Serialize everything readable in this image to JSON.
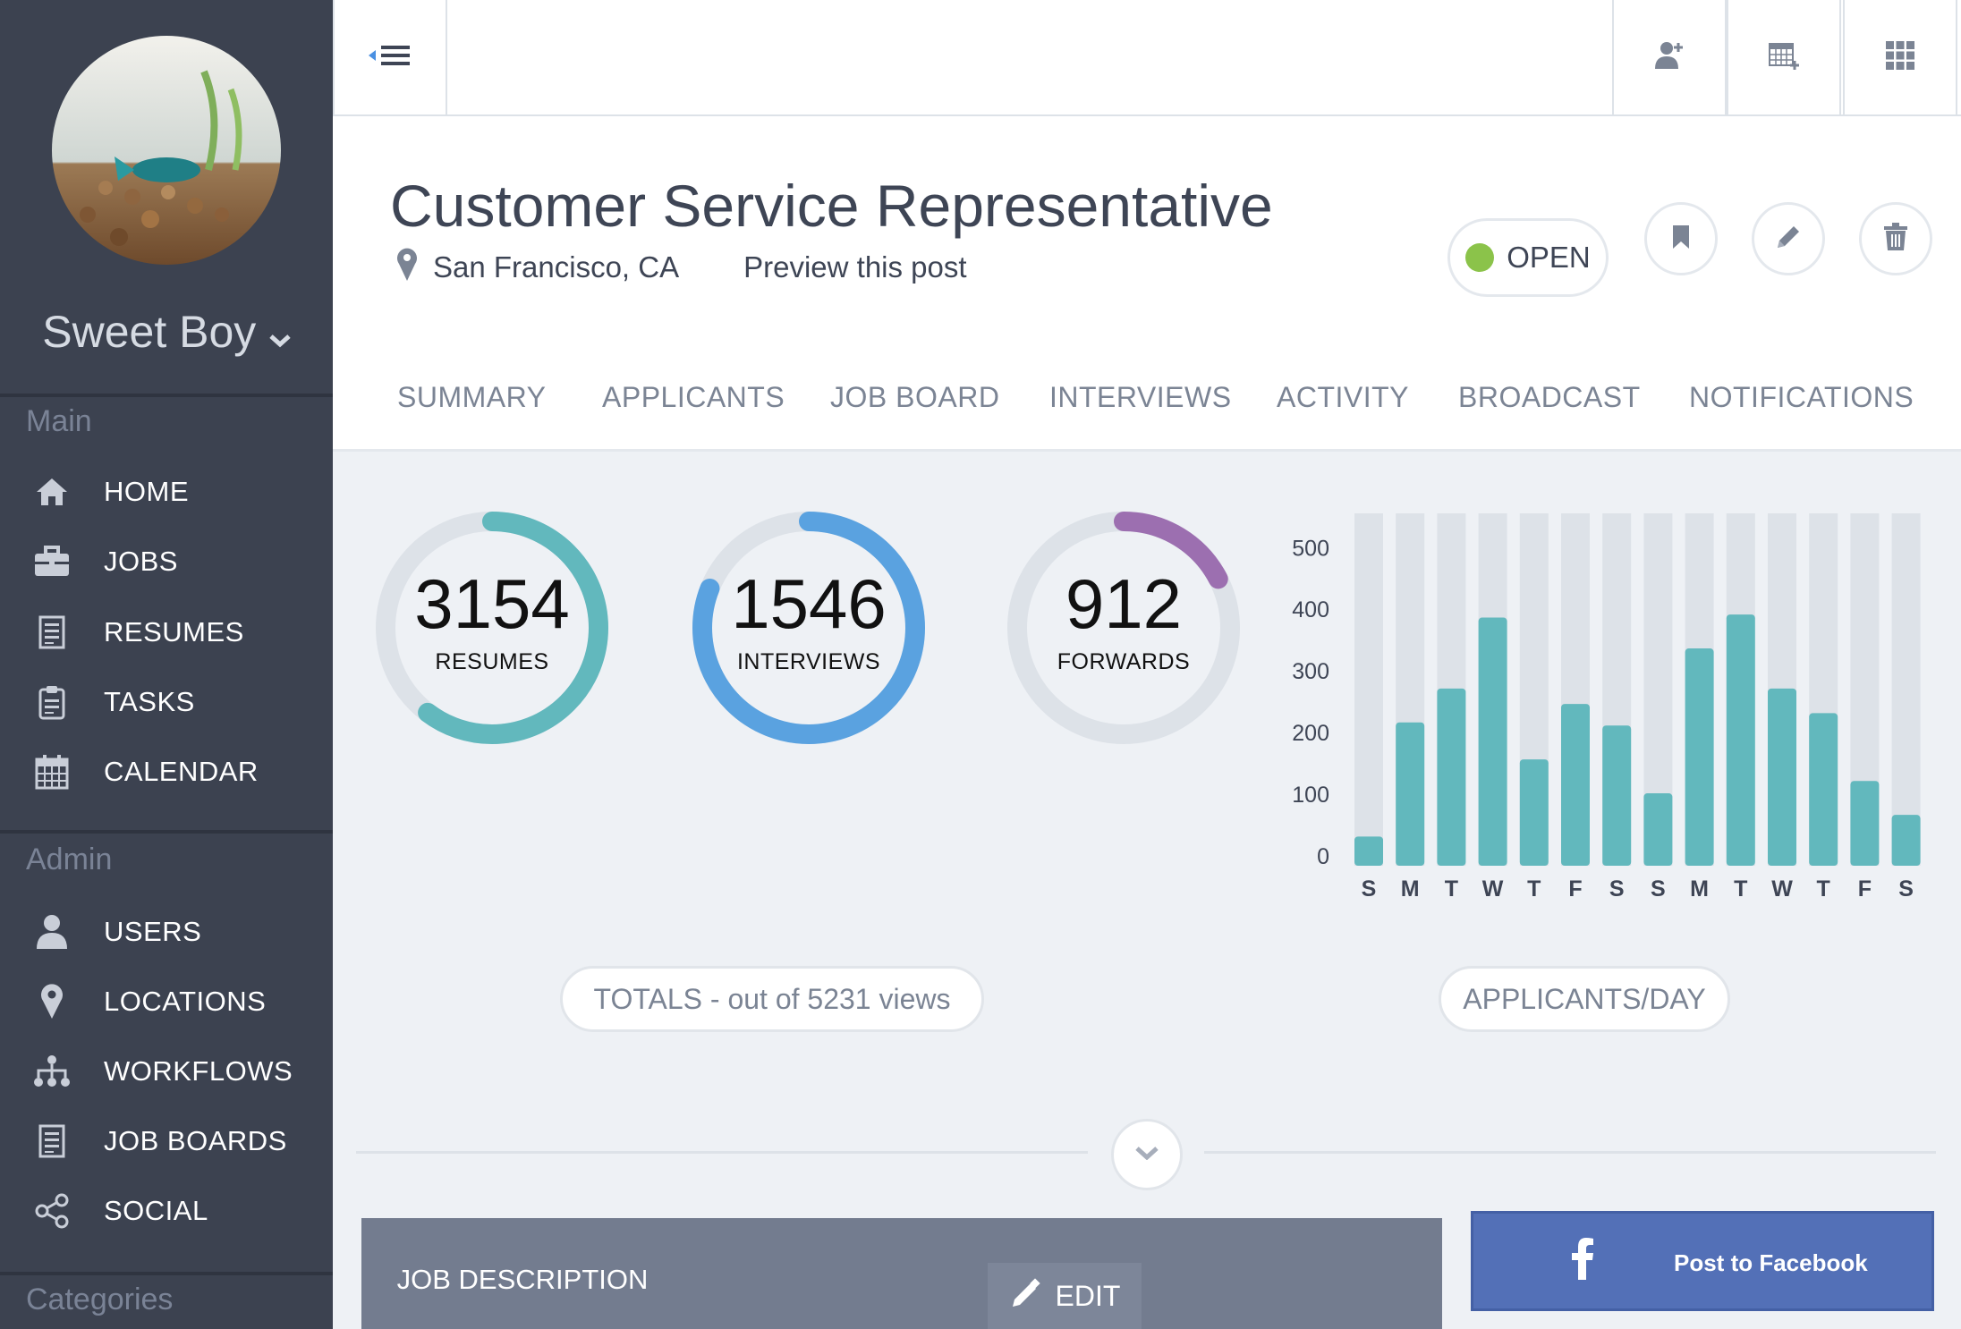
{
  "sidebar": {
    "user_name": "Sweet Boy",
    "sections": {
      "main": "Main",
      "admin": "Admin",
      "categories": "Categories"
    },
    "main_items": [
      {
        "label": "HOME",
        "icon": "home-icon"
      },
      {
        "label": "JOBS",
        "icon": "briefcase-icon"
      },
      {
        "label": "RESUMES",
        "icon": "document-icon"
      },
      {
        "label": "TASKS",
        "icon": "clipboard-icon"
      },
      {
        "label": "CALENDAR",
        "icon": "calendar-icon"
      }
    ],
    "admin_items": [
      {
        "label": "USERS",
        "icon": "user-icon"
      },
      {
        "label": "LOCATIONS",
        "icon": "map-pin-icon"
      },
      {
        "label": "WORKFLOWS",
        "icon": "sitemap-icon"
      },
      {
        "label": "JOB BOARDS",
        "icon": "document-icon"
      },
      {
        "label": "SOCIAL",
        "icon": "share-icon"
      }
    ]
  },
  "topbar": {
    "icons": [
      "menu-collapse-icon",
      "add-user-icon",
      "add-calendar-icon",
      "grid-icon"
    ]
  },
  "job": {
    "title": "Customer Service Representative",
    "location": "San Francisco, CA",
    "preview_link": "Preview this post",
    "status": "OPEN",
    "status_color": "#8bc34a"
  },
  "tabs": [
    "SUMMARY",
    "APPLICANTS",
    "JOB BOARD",
    "INTERVIEWS",
    "ACTIVITY",
    "BROADCAST",
    "NOTIFICATIONS"
  ],
  "stats": [
    {
      "value": "3154",
      "label": "RESUMES",
      "color": "#62b8bd",
      "fraction": 0.603
    },
    {
      "value": "1546",
      "label": "INTERVIEWS",
      "color": "#5aa2e0",
      "fraction": 0.81
    },
    {
      "value": "912",
      "label": "FORWARDS",
      "color": "#9c6fb0",
      "fraction": 0.174
    }
  ],
  "totals_label": "TOTALS - out of 5231 views",
  "applicants_label": "APPLICANTS/DAY",
  "chart_data": {
    "type": "bar",
    "categories": [
      "S",
      "M",
      "T",
      "W",
      "T",
      "F",
      "S",
      "S",
      "M",
      "T",
      "W",
      "T",
      "F",
      "S"
    ],
    "values": [
      30,
      215,
      270,
      385,
      155,
      245,
      210,
      100,
      335,
      390,
      270,
      230,
      120,
      65
    ],
    "ylim": [
      0,
      500
    ],
    "yticks": [
      "0",
      "100",
      "200",
      "300",
      "400",
      "500"
    ],
    "bar_color": "#62b8bd",
    "track_color": "#dde2e8"
  },
  "job_description": {
    "title": "JOB DESCRIPTION",
    "edit_label": "EDIT"
  },
  "facebook": {
    "label": "Post to Facebook"
  }
}
